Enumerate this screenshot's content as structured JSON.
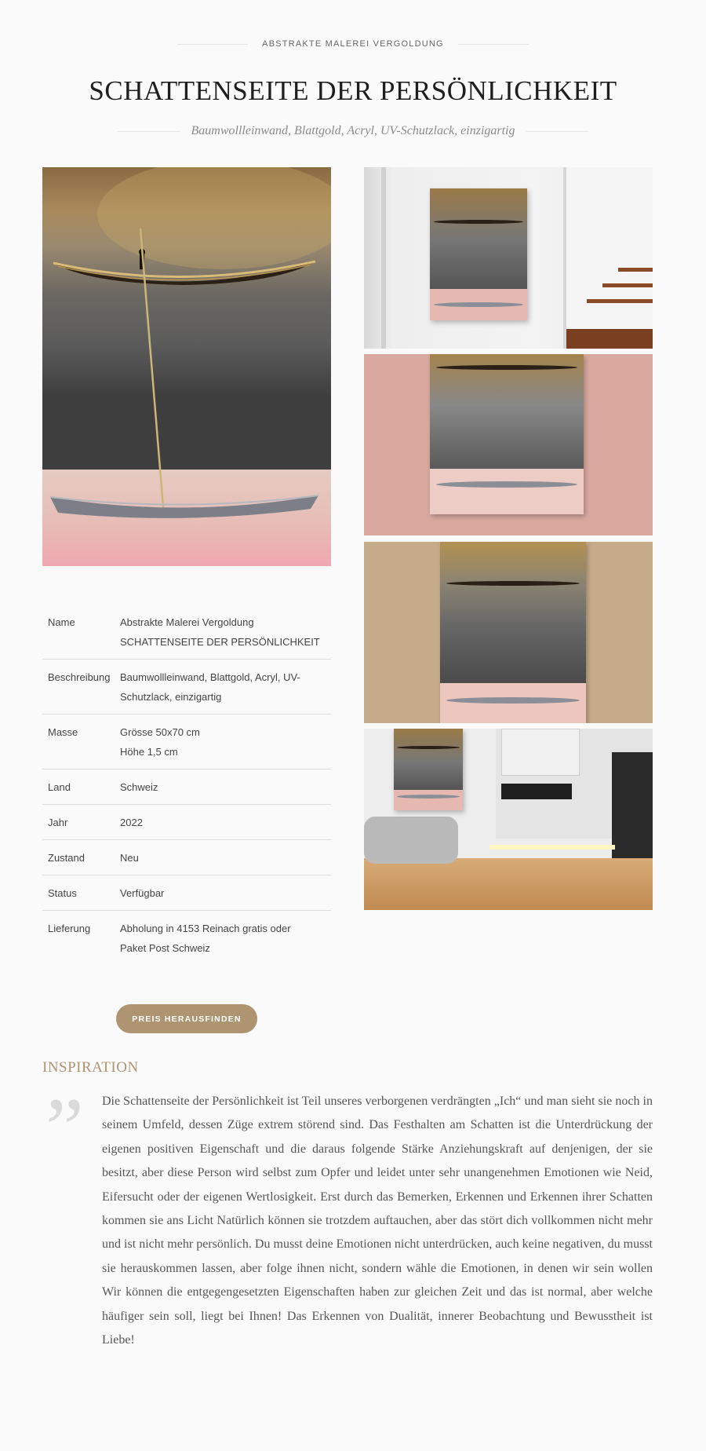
{
  "header": {
    "eyebrow": "ABSTRAKTE MALEREI VERGOLDUNG",
    "title": "SCHATTENSEITE DER PERSÖNLICHKEIT",
    "subtitle": "Baumwollleinwand, Blattgold, Acryl, UV-Schutzlack, einzigartig"
  },
  "gallery": {
    "main_image": "painting-boat-gold-pink",
    "thumbnails": [
      "painting-in-stairwell",
      "painting-on-pink-wall",
      "painting-on-beige-wall",
      "painting-in-living-room"
    ]
  },
  "specs": [
    {
      "label": "Name",
      "lines": [
        "Abstrakte Malerei Vergoldung",
        "SCHATTENSEITE DER PERSÖNLICHKEIT"
      ]
    },
    {
      "label": "Beschreibung",
      "lines": [
        "Baumwollleinwand, Blattgold, Acryl, UV-",
        "Schutzlack, einzigartig"
      ]
    },
    {
      "label": "Masse",
      "lines": [
        "Grösse 50x70 cm",
        "Höhe 1,5 cm"
      ]
    },
    {
      "label": "Land",
      "lines": [
        "Schweiz"
      ]
    },
    {
      "label": "Jahr",
      "lines": [
        "2022"
      ]
    },
    {
      "label": "Zustand",
      "lines": [
        "Neu"
      ]
    },
    {
      "label": "Status",
      "lines": [
        "Verfügbar"
      ]
    },
    {
      "label": "Lieferung",
      "lines": [
        "Abholung in 4153 Reinach gratis oder",
        "Paket Post Schweiz"
      ]
    }
  ],
  "cta": {
    "label": "PREIS HERAUSFINDEN"
  },
  "inspiration": {
    "heading": "INSPIRATION",
    "quote_glyph": "”",
    "text": "Die Schattenseite der Persönlichkeit ist Teil unseres verborgenen verdrängten „Ich“ und man sieht sie noch in seinem Umfeld, dessen Züge extrem störend sind. Das Festhalten am Schatten ist die Unterdrückung der eigenen positiven Eigenschaft und die daraus folgende Stärke Anziehungskraft auf denjenigen, der sie besitzt, aber diese Person wird selbst zum Opfer und leidet unter sehr unangenehmen Emotionen wie Neid, Eifersucht oder der eigenen Wertlosigkeit. Erst durch das Bemerken, Erkennen und Erkennen ihrer Schatten kommen sie ans Licht  Natürlich können sie trotzdem auftauchen, aber das stört dich vollkommen nicht mehr und ist nicht mehr persönlich. Du musst deine Emotionen nicht unterdrücken, auch keine negativen, du musst sie herauskommen lassen, aber folge ihnen nicht, sondern wähle die Emotionen, in denen wir sein wollen Wir können die entgegengesetzten Eigenschaften haben zur gleichen Zeit und das ist normal, aber welche häufiger sein soll, liegt bei Ihnen! Das Erkennen von Dualität, innerer Beobachtung und Bewusstheit ist Liebe!"
  },
  "colors": {
    "accent": "#ae9471",
    "title": "#1e1e1e",
    "background": "#fafafa"
  }
}
